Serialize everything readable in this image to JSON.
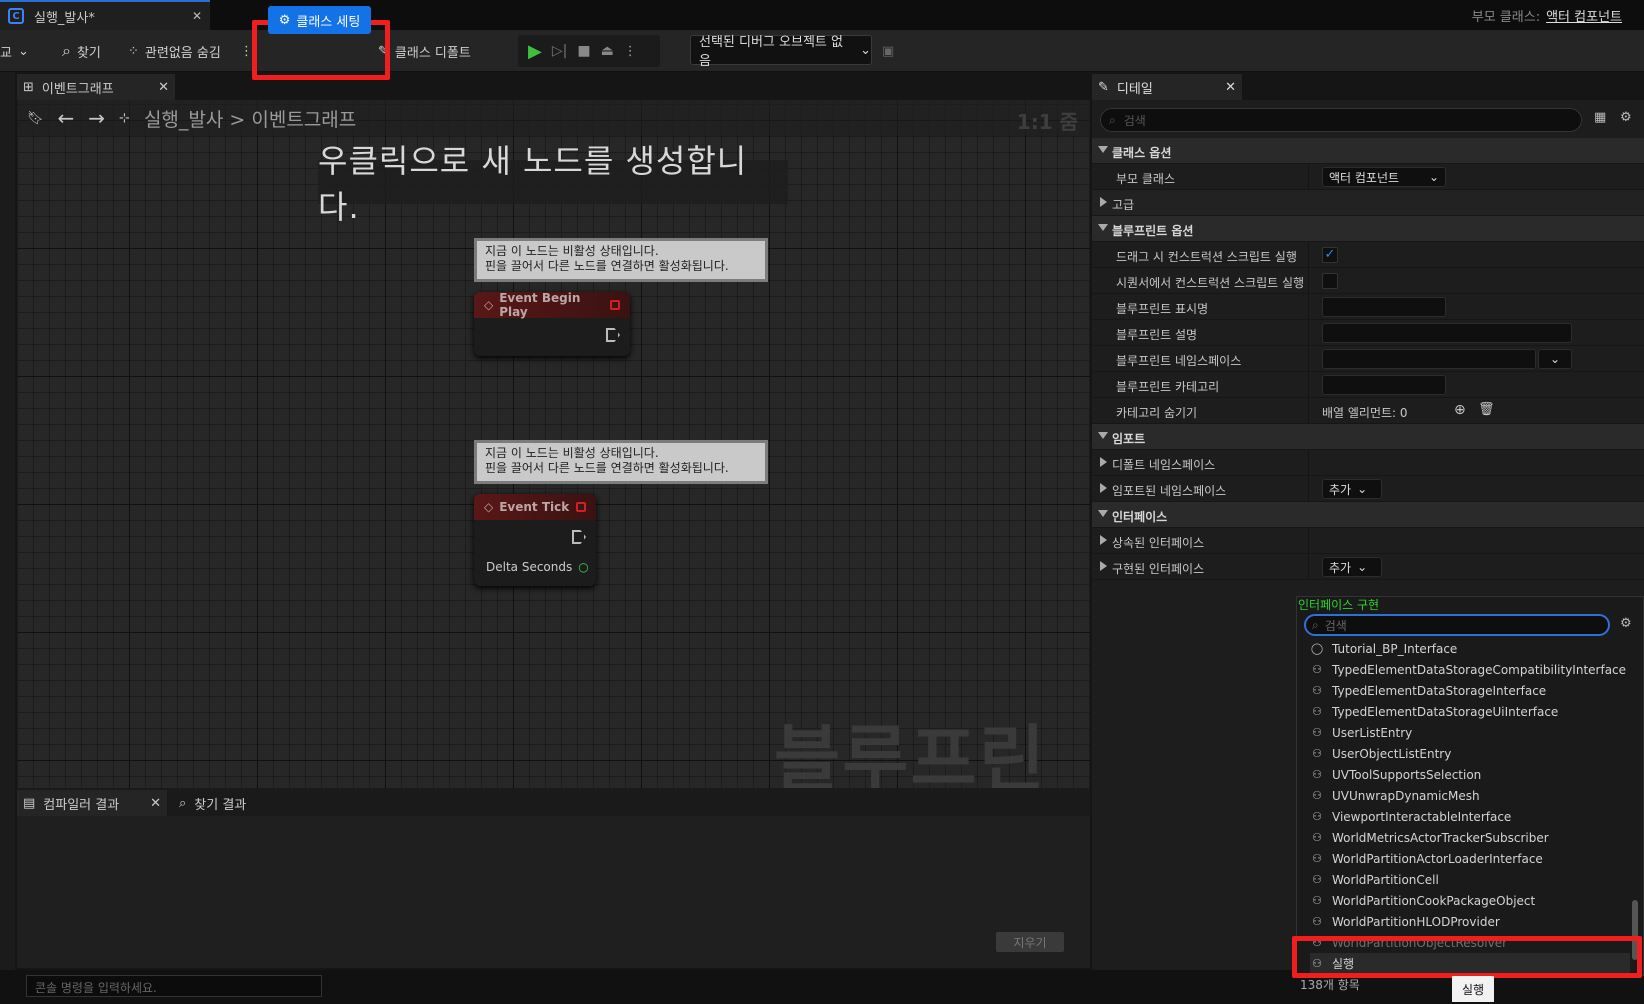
{
  "title_bar": {
    "tab_label": "실행_발사*",
    "parent_class_label": "부모 클래스:",
    "parent_class_value": "액터 컴포넌트"
  },
  "toolbar": {
    "left_cut_label": "교",
    "find": "찾기",
    "hide_unrelated": "관련없음 숨김",
    "class_settings": "클래스 세팅",
    "class_defaults": "클래스 디폴트",
    "debug_object": "선택된 디버그 오브젝트 없음"
  },
  "graph": {
    "tab_label": "이벤트그래프",
    "breadcrumb_root": "실행_발사",
    "breadcrumb_sep": ">",
    "breadcrumb_leaf": "이벤트그래프",
    "zoom": "1:1 줌",
    "hint": "우클릭으로 새 노드를 생성합니다.",
    "watermark": "블루프린트",
    "comment_line1": "지금 이 노드는 비활성 상태입니다.",
    "comment_line2": "핀을 끌어서 다른 노드를 연결하면 활성화됩니다.",
    "nodes": [
      {
        "title": "Event Begin Play"
      },
      {
        "title": "Event Tick",
        "pin": "Delta Seconds"
      }
    ]
  },
  "bottom": {
    "compiler_tab": "컴파일러 결과",
    "find_tab": "찾기 결과",
    "clear_button": "지우기",
    "console_placeholder": "콘솔 명령을 입력하세요."
  },
  "details": {
    "tab_label": "디테일",
    "search_placeholder": "검색",
    "rows": {
      "class_options": "클래스 옵션",
      "parent_class": "부모 클래스",
      "parent_class_value": "액터 컴포넌트",
      "advanced": "고급",
      "blueprint_options": "블루프린트 옵션",
      "run_construction_on_drag": "드래그 시 컨스트럭션 스크립트 실행",
      "run_construction_in_sequencer": "시퀀서에서 컨스트럭션 스크립트 실행",
      "blueprint_display_name": "블루프린트 표시명",
      "blueprint_description": "블루프린트 설명",
      "blueprint_namespace": "블루프린트 네임스페이스",
      "blueprint_category": "블루프린트 카테고리",
      "hide_categories": "카테고리 숨기기",
      "array_elements": "배열 엘리먼트: 0",
      "imports": "임포트",
      "default_namespaces": "디폴트 네임스페이스",
      "imported_namespaces": "임포트된 네임스페이스",
      "add": "추가",
      "interfaces": "인터페이스",
      "inherited_interfaces": "상속된 인터페이스",
      "implemented_interfaces": "구현된 인터페이스"
    }
  },
  "popup": {
    "title": "인터페이스 구현",
    "search_placeholder": "검색",
    "items": [
      {
        "label": "Tutorial_BP_Interface",
        "icon": "circle-icon"
      },
      {
        "label": "TypedElementDataStorageCompatibilityInterface",
        "icon": "interface-icon"
      },
      {
        "label": "TypedElementDataStorageInterface",
        "icon": "interface-icon"
      },
      {
        "label": "TypedElementDataStorageUiInterface",
        "icon": "interface-icon"
      },
      {
        "label": "UserListEntry",
        "icon": "interface-icon"
      },
      {
        "label": "UserObjectListEntry",
        "icon": "interface-icon"
      },
      {
        "label": "UVToolSupportsSelection",
        "icon": "interface-icon"
      },
      {
        "label": "UVUnwrapDynamicMesh",
        "icon": "interface-icon"
      },
      {
        "label": "ViewportInteractableInterface",
        "icon": "interface-icon"
      },
      {
        "label": "WorldMetricsActorTrackerSubscriber",
        "icon": "interface-icon"
      },
      {
        "label": "WorldPartitionActorLoaderInterface",
        "icon": "interface-icon"
      },
      {
        "label": "WorldPartitionCell",
        "icon": "interface-icon"
      },
      {
        "label": "WorldPartitionCookPackageObject",
        "icon": "interface-icon"
      },
      {
        "label": "WorldPartitionHLODProvider",
        "icon": "interface-icon"
      },
      {
        "label": "WorldPartitionObjectResolver",
        "icon": "interface-icon"
      },
      {
        "label": "실행",
        "icon": "interface-icon"
      }
    ],
    "count": "138개 항목",
    "tooltip": "실행"
  },
  "colors": {
    "accent_blue": "#1372e5",
    "highlight_red": "#f01e1e",
    "popup_title_green": "#2dd42d"
  }
}
